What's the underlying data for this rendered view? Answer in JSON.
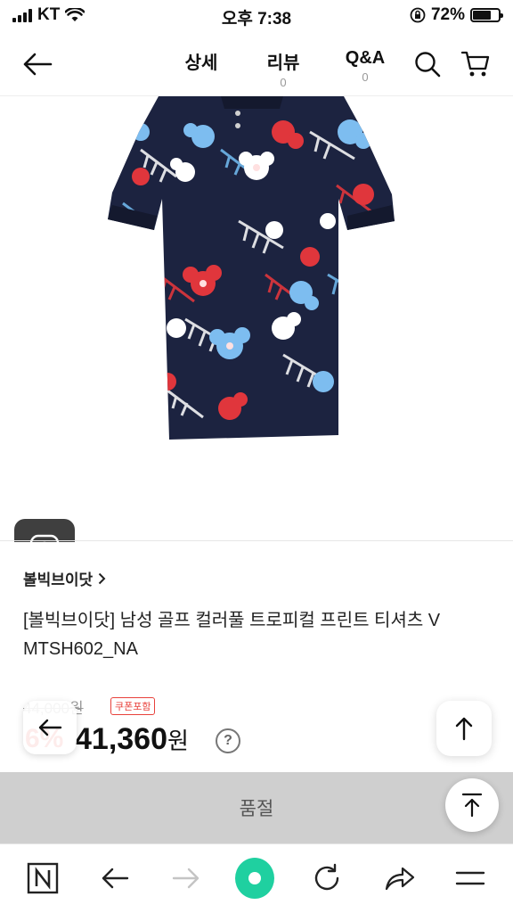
{
  "status_bar": {
    "carrier": "KT",
    "time": "오후 7:38",
    "battery_percent": "72%"
  },
  "header": {
    "tabs": [
      {
        "label": "상세",
        "count": ""
      },
      {
        "label": "리뷰",
        "count": "0"
      },
      {
        "label": "Q&A",
        "count": "0"
      }
    ]
  },
  "product": {
    "brand": "볼빅브이닷",
    "title": "[볼빅브이닷] 남성 골프 컬러풀 트로피컬 프린트 티셔츠 V MTSH602_NA",
    "original_price": "44,000원",
    "coupon_badge": "쿠폰포함",
    "discount": "6%",
    "price": "41,360",
    "price_unit": "원",
    "help": "?"
  },
  "actions": {
    "soldout_label": "품절"
  },
  "colors": {
    "accent_red": "#e8413b",
    "soldout_bg": "#cfcfcf",
    "home_green": "#1fd0a0",
    "shirt_navy": "#1c2340"
  }
}
